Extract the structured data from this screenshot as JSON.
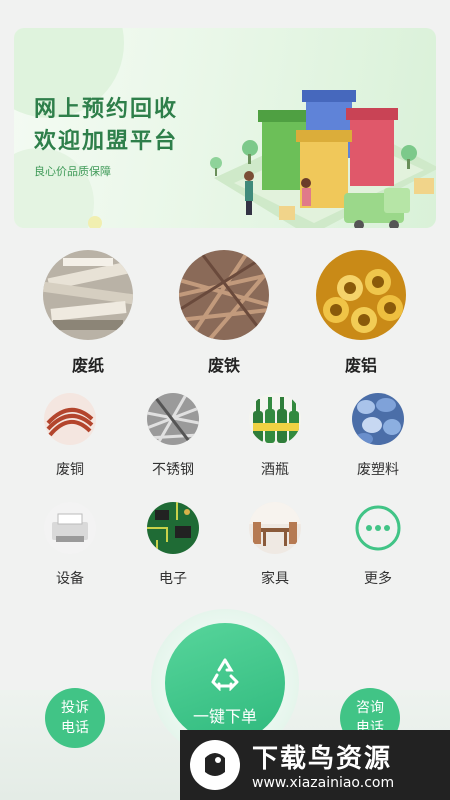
{
  "banner": {
    "title_line1": "网上预约回收",
    "title_line2": "欢迎加盟平台",
    "subtitle": "良心价品质保障"
  },
  "featured_categories": [
    {
      "label": "废纸",
      "icon": "waste-paper-photo"
    },
    {
      "label": "废铁",
      "icon": "scrap-iron-photo"
    },
    {
      "label": "废铝",
      "icon": "scrap-aluminum-photo"
    }
  ],
  "categories_row1": [
    {
      "label": "废铜",
      "icon": "copper-wire-photo"
    },
    {
      "label": "不锈钢",
      "icon": "stainless-steel-photo"
    },
    {
      "label": "酒瓶",
      "icon": "beer-bottles-photo"
    },
    {
      "label": "废塑料",
      "icon": "plastic-bottles-photo"
    }
  ],
  "categories_row2": [
    {
      "label": "设备",
      "icon": "printer-photo"
    },
    {
      "label": "电子",
      "icon": "circuit-board-photo"
    },
    {
      "label": "家具",
      "icon": "furniture-photo"
    },
    {
      "label": "更多",
      "icon": "more-dots-icon"
    }
  ],
  "actions": {
    "order_label": "一键下单",
    "complain_line1": "投诉",
    "complain_line2": "电话",
    "consult_line1": "咨询",
    "consult_line2": "电话"
  },
  "watermark": {
    "title": "下载鸟资源",
    "url": "www.xiazainiao.com"
  },
  "colors": {
    "accent": "#41c486",
    "banner_text": "#2e7f4a"
  }
}
